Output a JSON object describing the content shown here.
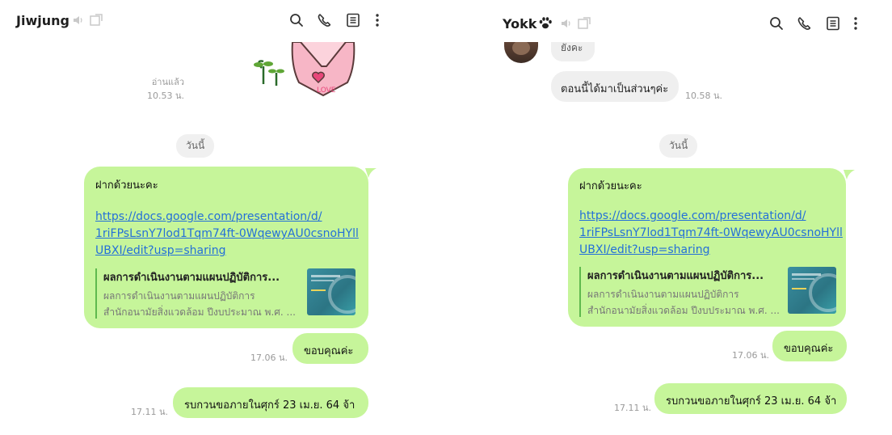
{
  "left": {
    "title": "Jiwjung",
    "read_label": "อ่านแล้ว",
    "sticker_time": "10.53 น.",
    "date_pill": "วันนี้",
    "msg_text": "ฝากด้วยนะคะ",
    "link_lines": [
      "https://docs.google.com/presentation/d/",
      "1riFPsLsnY7lod1Tqm74ft-0WqewyAU0csnoHYll",
      "UBXI/edit?usp=sharing"
    ],
    "preview_title": "ผลการดำเนินงานตามแผนปฏิบัติการ...",
    "preview_desc1": "ผลการดำเนินงานตามแผนปฏิบัติการ",
    "preview_desc2": "สำนักอนามัยสิ่งแวดล้อม ปีงบประมาณ พ.ศ. ...",
    "thanks_text": "ขอบคุณค่ะ",
    "thanks_time": "17.06 น.",
    "last_text": "รบกวนขอภายในศุกร์ 23 เม.ย. 64 จ้า",
    "last_time": "17.11 น."
  },
  "right": {
    "title": "Yokk",
    "partial_text": "ยังคะ",
    "msg_gray": "ตอนนี้ได้มาเป็นส่วนๆค่ะ",
    "msg_gray_time": "10.58 น.",
    "date_pill": "วันนี้",
    "msg_text": "ฝากด้วยนะคะ",
    "link_lines": [
      "https://docs.google.com/presentation/d/",
      "1riFPsLsnY7lod1Tqm74ft-0WqewyAU0csnoHYll",
      "UBXI/edit?usp=sharing"
    ],
    "preview_title": "ผลการดำเนินงานตามแผนปฏิบัติการ...",
    "preview_desc1": "ผลการดำเนินงานตามแผนปฏิบัติการ",
    "preview_desc2": "สำนักอนามัยสิ่งแวดล้อม ปีงบประมาณ พ.ศ. ...",
    "thanks_text": "ขอบคุณค่ะ",
    "thanks_time": "17.06 น.",
    "last_text": "รบกวนขอภายในศุกร์ 23 เม.ย. 64 จ้า",
    "last_time": "17.11 น."
  },
  "icons": [
    "speaker-icon",
    "popout-icon",
    "search-icon",
    "phone-icon",
    "notes-icon",
    "more-icon",
    "paw-icon"
  ],
  "colors": {
    "bubble_green": "#c6f59a",
    "link_blue": "#2470d8",
    "time_gray": "#9a9a9a",
    "preview_bar": "#5fb94e"
  }
}
